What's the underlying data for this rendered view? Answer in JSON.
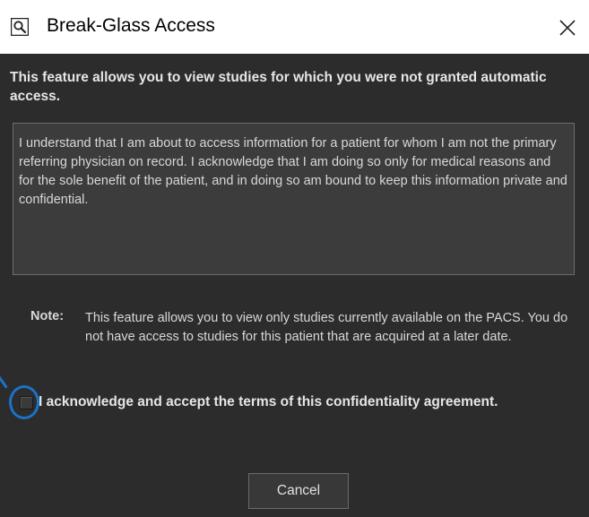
{
  "window": {
    "title": "Break-Glass Access",
    "app_icon": "magnifier-document-icon",
    "close_icon": "close-icon"
  },
  "dialog": {
    "intro": "This feature allows you to view studies for which you were not granted automatic access.",
    "agreement_text": "I understand that I am about to access information for a patient for whom I am not the primary referring physician on record. I acknowledge that I am doing so only for medical reasons and for the sole benefit of the patient, and in doing so am bound to keep this information private and confidential.",
    "note_label": "Note:",
    "note_text": "This feature allows you to view only studies currently available on the PACS. You do not have access to studies for this patient that are acquired at a later date.",
    "acknowledge_label": "I acknowledge and accept the terms of this confidentiality agreement.",
    "acknowledge_checked": false,
    "cancel_label": "Cancel"
  },
  "colors": {
    "dialog_background": "#2c2c2c",
    "text_area_background": "#3c3c3c",
    "highlight_annotation": "#1a73c8"
  }
}
